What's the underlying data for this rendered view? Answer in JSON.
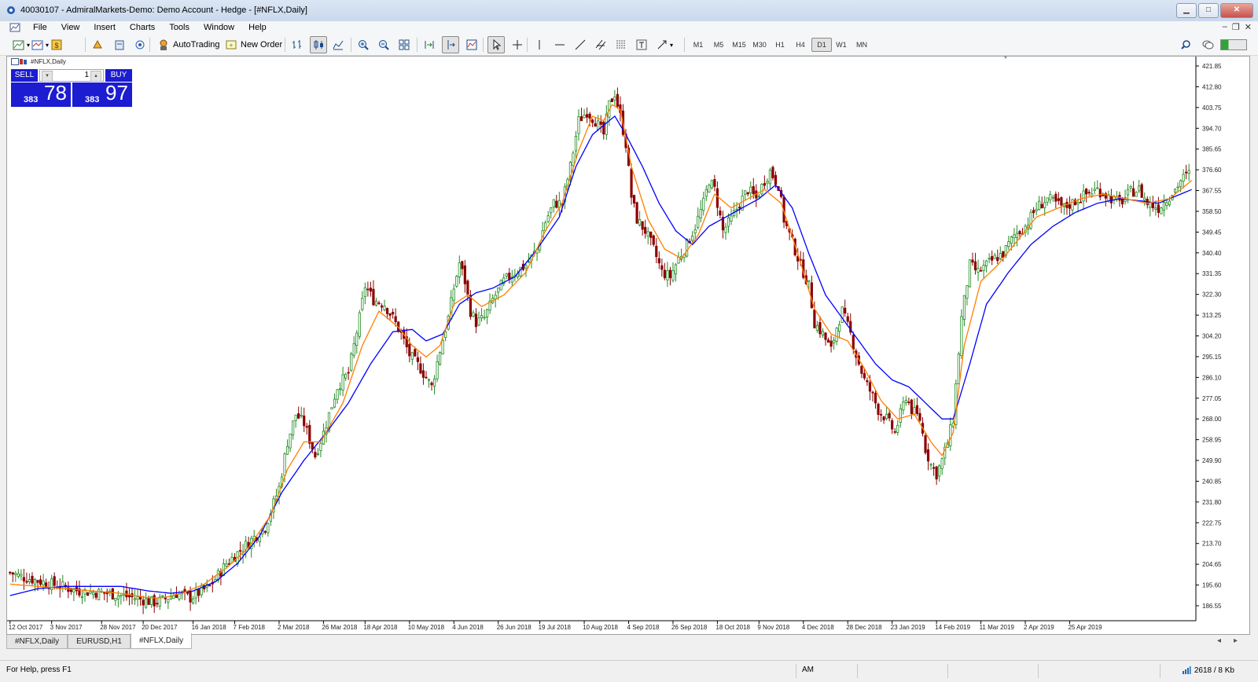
{
  "window": {
    "title": "40030107 - AdmiralMarkets-Demo: Demo Account - Hedge - [#NFLX,Daily]",
    "min": "▁",
    "max": "□",
    "close": "✕"
  },
  "menu": {
    "items": [
      "File",
      "View",
      "Insert",
      "Charts",
      "Tools",
      "Window",
      "Help"
    ]
  },
  "toolbar": {
    "autotrading_label": "AutoTrading",
    "new_order_label": "New Order",
    "timeframes": [
      "M1",
      "M5",
      "M15",
      "M30",
      "H1",
      "H4",
      "D1",
      "W1",
      "MN"
    ],
    "active_timeframe": "D1"
  },
  "chart": {
    "label": "#NFLX,Daily",
    "one_click": {
      "sell_label": "SELL",
      "buy_label": "BUY",
      "lot": "1",
      "sell_small": "383",
      "sell_big": "78",
      "buy_small": "383",
      "buy_big": "97"
    },
    "colors": {
      "bull": "#228b22",
      "bear": "#8b0000",
      "ma_fast": "#ff7f00",
      "ma_slow": "#0000ff"
    }
  },
  "chart_data": {
    "type": "candlestick",
    "title": "#NFLX,Daily",
    "ylim": [
      181.75,
      424.25
    ],
    "y_ticks": [
      "421.85",
      "412.80",
      "403.75",
      "394.70",
      "385.65",
      "376.60",
      "367.55",
      "358.50",
      "349.45",
      "340.40",
      "331.35",
      "322.30",
      "313.25",
      "304.20",
      "295.15",
      "286.10",
      "277.05",
      "268.00",
      "258.95",
      "249.90",
      "240.85",
      "231.80",
      "222.75",
      "213.70",
      "204.65",
      "195.60",
      "186.55"
    ],
    "x_ticks": [
      "12 Oct 2017",
      "3 Nov 2017",
      "28 Nov 2017",
      "20 Dec 2017",
      "16 Jan 2018",
      "7 Feb 2018",
      "2 Mar 2018",
      "26 Mar 2018",
      "18 Apr 2018",
      "10 May 2018",
      "4 Jun 2018",
      "26 Jun 2018",
      "19 Jul 2018",
      "10 Aug 2018",
      "4 Sep 2018",
      "26 Sep 2018",
      "18 Oct 2018",
      "9 Nov 2018",
      "4 Dec 2018",
      "28 Dec 2018",
      "23 Jan 2019",
      "14 Feb 2019",
      "11 Mar 2019",
      "2 Apr 2019",
      "25 Apr 2019"
    ],
    "close_path": [
      [
        0,
        201
      ],
      [
        5,
        199
      ],
      [
        15,
        196
      ],
      [
        25,
        193
      ],
      [
        35,
        192
      ],
      [
        45,
        190
      ],
      [
        52,
        188
      ],
      [
        55,
        189
      ],
      [
        60,
        192
      ],
      [
        65,
        190
      ],
      [
        72,
        195
      ],
      [
        78,
        205
      ],
      [
        85,
        213
      ],
      [
        92,
        221
      ],
      [
        97,
        238
      ],
      [
        100,
        258
      ],
      [
        103,
        270
      ],
      [
        106,
        266
      ],
      [
        110,
        252
      ],
      [
        113,
        262
      ],
      [
        118,
        282
      ],
      [
        122,
        288
      ],
      [
        126,
        312
      ],
      [
        128,
        326
      ],
      [
        131,
        320
      ],
      [
        135,
        318
      ],
      [
        138,
        312
      ],
      [
        141,
        305
      ],
      [
        144,
        296
      ],
      [
        148,
        290
      ],
      [
        152,
        282
      ],
      [
        155,
        298
      ],
      [
        158,
        312
      ],
      [
        160,
        325
      ],
      [
        162,
        336
      ],
      [
        164,
        328
      ],
      [
        166,
        315
      ],
      [
        168,
        310
      ],
      [
        171,
        312
      ],
      [
        174,
        320
      ],
      [
        178,
        328
      ],
      [
        182,
        332
      ],
      [
        186,
        335
      ],
      [
        190,
        342
      ],
      [
        193,
        354
      ],
      [
        196,
        362
      ],
      [
        199,
        362
      ],
      [
        202,
        378
      ],
      [
        205,
        398
      ],
      [
        208,
        402
      ],
      [
        211,
        398
      ],
      [
        214,
        392
      ],
      [
        216,
        405
      ],
      [
        218,
        410
      ],
      [
        220,
        400
      ],
      [
        222,
        388
      ],
      [
        224,
        365
      ],
      [
        226,
        355
      ],
      [
        229,
        350
      ],
      [
        232,
        342
      ],
      [
        235,
        332
      ],
      [
        238,
        330
      ],
      [
        241,
        338
      ],
      [
        244,
        344
      ],
      [
        247,
        352
      ],
      [
        250,
        362
      ],
      [
        252,
        372
      ],
      [
        254,
        368
      ],
      [
        257,
        350
      ],
      [
        260,
        355
      ],
      [
        263,
        362
      ],
      [
        266,
        368
      ],
      [
        269,
        364
      ],
      [
        272,
        372
      ],
      [
        274,
        376
      ],
      [
        277,
        370
      ],
      [
        279,
        355
      ],
      [
        282,
        345
      ],
      [
        285,
        335
      ],
      [
        288,
        326
      ],
      [
        290,
        310
      ],
      [
        293,
        305
      ],
      [
        296,
        298
      ],
      [
        298,
        308
      ],
      [
        300,
        315
      ],
      [
        303,
        305
      ],
      [
        305,
        296
      ],
      [
        308,
        285
      ],
      [
        311,
        278
      ],
      [
        313,
        272
      ],
      [
        316,
        268
      ],
      [
        319,
        262
      ],
      [
        321,
        270
      ],
      [
        323,
        278
      ],
      [
        325,
        272
      ],
      [
        328,
        268
      ],
      [
        330,
        255
      ],
      [
        332,
        248
      ],
      [
        334,
        244
      ],
      [
        336,
        250
      ],
      [
        338,
        258
      ],
      [
        340,
        268
      ],
      [
        343,
        312
      ],
      [
        346,
        335
      ],
      [
        349,
        332
      ],
      [
        352,
        335
      ],
      [
        355,
        338
      ],
      [
        358,
        340
      ],
      [
        362,
        348
      ],
      [
        366,
        352
      ],
      [
        370,
        360
      ],
      [
        374,
        364
      ],
      [
        377,
        362
      ],
      [
        380,
        360
      ],
      [
        384,
        363
      ],
      [
        388,
        366
      ],
      [
        392,
        368
      ],
      [
        396,
        365
      ],
      [
        400,
        362
      ],
      [
        404,
        367
      ],
      [
        407,
        368
      ],
      [
        410,
        362
      ],
      [
        414,
        360
      ],
      [
        417,
        364
      ],
      [
        420,
        368
      ],
      [
        422,
        372
      ],
      [
        425,
        375
      ]
    ],
    "ma_fast_path": [
      [
        0,
        196
      ],
      [
        10,
        195
      ],
      [
        20,
        194
      ],
      [
        30,
        193
      ],
      [
        40,
        192
      ],
      [
        50,
        190
      ],
      [
        55,
        190
      ],
      [
        62,
        192
      ],
      [
        70,
        196
      ],
      [
        78,
        203
      ],
      [
        86,
        212
      ],
      [
        94,
        226
      ],
      [
        100,
        246
      ],
      [
        106,
        258
      ],
      [
        112,
        258
      ],
      [
        120,
        275
      ],
      [
        127,
        300
      ],
      [
        133,
        315
      ],
      [
        140,
        308
      ],
      [
        145,
        300
      ],
      [
        150,
        295
      ],
      [
        155,
        300
      ],
      [
        160,
        318
      ],
      [
        165,
        322
      ],
      [
        170,
        317
      ],
      [
        178,
        322
      ],
      [
        186,
        332
      ],
      [
        193,
        350
      ],
      [
        199,
        362
      ],
      [
        205,
        385
      ],
      [
        210,
        400
      ],
      [
        214,
        398
      ],
      [
        217,
        405
      ],
      [
        220,
        403
      ],
      [
        224,
        378
      ],
      [
        230,
        355
      ],
      [
        236,
        342
      ],
      [
        242,
        338
      ],
      [
        248,
        348
      ],
      [
        254,
        366
      ],
      [
        260,
        360
      ],
      [
        266,
        364
      ],
      [
        272,
        368
      ],
      [
        278,
        362
      ],
      [
        284,
        340
      ],
      [
        290,
        316
      ],
      [
        296,
        305
      ],
      [
        302,
        302
      ],
      [
        308,
        290
      ],
      [
        314,
        276
      ],
      [
        320,
        268
      ],
      [
        326,
        270
      ],
      [
        332,
        258
      ],
      [
        336,
        252
      ],
      [
        340,
        262
      ],
      [
        344,
        300
      ],
      [
        350,
        328
      ],
      [
        356,
        335
      ],
      [
        362,
        344
      ],
      [
        370,
        356
      ],
      [
        378,
        360
      ],
      [
        386,
        364
      ],
      [
        394,
        366
      ],
      [
        402,
        364
      ],
      [
        410,
        362
      ],
      [
        418,
        364
      ],
      [
        424,
        370
      ],
      [
        426,
        372
      ]
    ],
    "ma_slow_path": [
      [
        0,
        191
      ],
      [
        10,
        194
      ],
      [
        20,
        195
      ],
      [
        30,
        195
      ],
      [
        40,
        195
      ],
      [
        50,
        193
      ],
      [
        58,
        192
      ],
      [
        66,
        193
      ],
      [
        74,
        197
      ],
      [
        82,
        205
      ],
      [
        90,
        217
      ],
      [
        98,
        236
      ],
      [
        106,
        250
      ],
      [
        114,
        262
      ],
      [
        122,
        275
      ],
      [
        130,
        292
      ],
      [
        138,
        306
      ],
      [
        145,
        307
      ],
      [
        150,
        302
      ],
      [
        156,
        305
      ],
      [
        162,
        318
      ],
      [
        168,
        323
      ],
      [
        174,
        325
      ],
      [
        182,
        330
      ],
      [
        190,
        342
      ],
      [
        198,
        356
      ],
      [
        204,
        378
      ],
      [
        210,
        392
      ],
      [
        214,
        396
      ],
      [
        218,
        400
      ],
      [
        222,
        392
      ],
      [
        228,
        378
      ],
      [
        234,
        362
      ],
      [
        240,
        350
      ],
      [
        246,
        344
      ],
      [
        252,
        352
      ],
      [
        258,
        356
      ],
      [
        264,
        360
      ],
      [
        270,
        364
      ],
      [
        276,
        370
      ],
      [
        282,
        360
      ],
      [
        288,
        340
      ],
      [
        294,
        322
      ],
      [
        300,
        312
      ],
      [
        306,
        302
      ],
      [
        312,
        292
      ],
      [
        318,
        285
      ],
      [
        324,
        282
      ],
      [
        330,
        275
      ],
      [
        336,
        268
      ],
      [
        340,
        268
      ],
      [
        346,
        292
      ],
      [
        352,
        318
      ],
      [
        360,
        332
      ],
      [
        368,
        344
      ],
      [
        376,
        352
      ],
      [
        384,
        358
      ],
      [
        392,
        362
      ],
      [
        400,
        364
      ],
      [
        408,
        363
      ],
      [
        414,
        362
      ],
      [
        420,
        365
      ],
      [
        426,
        368
      ]
    ]
  },
  "tabs": [
    "#NFLX,Daily",
    "EURUSD,H1",
    "#NFLX,Daily"
  ],
  "active_tab": 2,
  "status": {
    "help": "For Help, press F1",
    "mid": "AM",
    "traffic": "2618 / 8 Kb"
  }
}
